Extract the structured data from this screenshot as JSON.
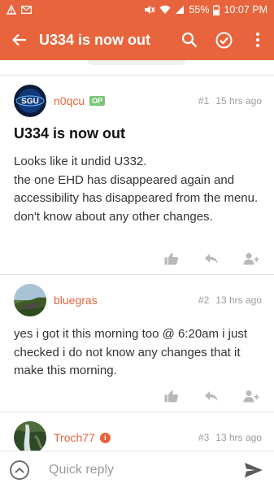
{
  "status_bar": {
    "battery": "55%",
    "time": "10:07 PM",
    "icons": [
      "alert-icon",
      "email-icon",
      "mute-icon",
      "wifi-icon",
      "signal-icon",
      "battery-icon"
    ]
  },
  "app_bar": {
    "title": "U334 is now out",
    "icons": [
      "back-arrow-icon",
      "search-icon",
      "check-circle-icon",
      "more-vert-icon"
    ]
  },
  "colors": {
    "accent": "#e8643c",
    "op_badge": "#7cc576",
    "muted_text": "#9b9b9b"
  },
  "posts": [
    {
      "author": "n0qcu",
      "badge": "OP",
      "number": "#1",
      "time": "15 hrs ago",
      "title": "U334 is now out",
      "body": [
        "Looks like it undid U332.",
        "the one EHD has disappeared again and accessibility has disappeared from the menu.",
        "don't know about any other changes."
      ],
      "avatar_text": "SGU",
      "actions": [
        "like-icon",
        "reply-icon",
        "follow-user-icon"
      ]
    },
    {
      "author": "bluegras",
      "number": "#2",
      "time": "13 hrs ago",
      "body": [
        "yes i got it this morning too @ 6:20am i just checked i do not know any changes that it make this morning."
      ],
      "actions": [
        "like-icon",
        "reply-icon",
        "follow-user-icon"
      ]
    },
    {
      "author": "Troch77",
      "badge": "moderator",
      "number": "#3",
      "time": "13 hrs ago"
    }
  ],
  "quick_reply": {
    "placeholder": "Quick reply",
    "value": ""
  }
}
